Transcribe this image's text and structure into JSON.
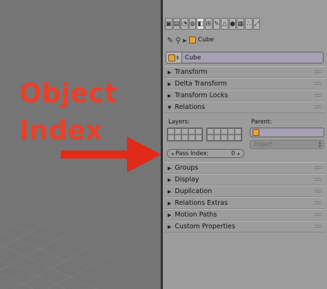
{
  "annotation": {
    "line1": "Object",
    "line2": "Index"
  },
  "colors": {
    "annotation_red": "#e8402a",
    "panel_bg": "#9c9c9c",
    "viewport_bg": "#757575",
    "id_field": "#a6a1b5"
  },
  "tabs": [
    {
      "icon": "camera-icon",
      "glyph": "▣"
    },
    {
      "icon": "layers-icon",
      "glyph": "▤"
    },
    {
      "icon": "scene-icon",
      "glyph": "◔"
    },
    {
      "icon": "world-icon",
      "glyph": "◍"
    },
    {
      "icon": "object-icon",
      "glyph": "◧",
      "active": true
    },
    {
      "icon": "constraints-icon",
      "glyph": "⊞"
    },
    {
      "icon": "modifiers-icon",
      "glyph": "✎"
    },
    {
      "icon": "data-icon",
      "glyph": "△"
    },
    {
      "icon": "material-icon",
      "glyph": "●"
    },
    {
      "icon": "texture-icon",
      "glyph": "▦"
    },
    {
      "icon": "particles-icon",
      "glyph": "∴"
    },
    {
      "icon": "physics-icon",
      "glyph": "⤢"
    }
  ],
  "breadcrumb": {
    "object_name": "Cube"
  },
  "object": {
    "name": "Cube"
  },
  "sections": {
    "transform": "Transform",
    "delta_transform": "Delta Transform",
    "transform_locks": "Transform Locks",
    "relations": "Relations",
    "groups": "Groups",
    "display": "Display",
    "duplication": "Duplication",
    "relations_extras": "Relations Extras",
    "motion_paths": "Motion Paths",
    "custom_properties": "Custom Properties"
  },
  "relations": {
    "layers_label": "Layers:",
    "parent_label": "Parent:",
    "parent_type": "Object",
    "pass_index_label": "Pass Index:",
    "pass_index_value": "0"
  }
}
